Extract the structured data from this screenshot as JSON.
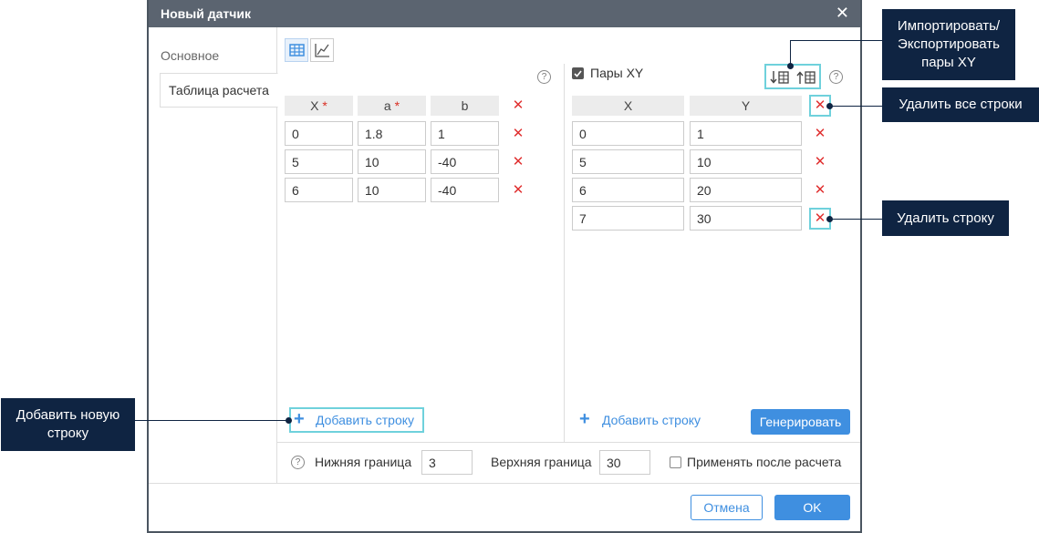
{
  "dialog": {
    "title": "Новый датчик",
    "close": "✕"
  },
  "sidebar": {
    "tabs": [
      {
        "label": "Основное"
      },
      {
        "label": "Таблица расчета"
      }
    ]
  },
  "left_table": {
    "headers": [
      "X",
      "a",
      "b"
    ],
    "required_mark": "*",
    "rows": [
      [
        "0",
        "1.8",
        "1"
      ],
      [
        "5",
        "10",
        "-40"
      ],
      [
        "6",
        "10",
        "-40"
      ]
    ],
    "add_row": "Добавить строку"
  },
  "right_table": {
    "pairs_label": "Пары XY",
    "headers": [
      "X",
      "Y"
    ],
    "rows": [
      [
        "0",
        "1"
      ],
      [
        "5",
        "10"
      ],
      [
        "6",
        "20"
      ],
      [
        "7",
        "30"
      ]
    ],
    "add_row": "Добавить строку",
    "generate": "Генерировать"
  },
  "bounds": {
    "lower_label": "Нижняя граница",
    "lower_value": "3",
    "upper_label": "Верхняя граница",
    "upper_value": "30",
    "apply_label": "Применять после расчета"
  },
  "footer": {
    "cancel": "Отмена",
    "ok": "OK"
  },
  "callouts": {
    "import_export": "Импортировать/ Экспортировать пары XY",
    "delete_all": "Удалить все строки",
    "delete_row": "Удалить строку",
    "add_row": "Добавить новую строку"
  },
  "colors": {
    "accent": "#3f8fe0",
    "callout": "#0f2442",
    "highlight": "#6fd1dc",
    "delete": "#e03030"
  },
  "icons": {
    "help": "?",
    "delete": "✕",
    "plus": "+"
  }
}
